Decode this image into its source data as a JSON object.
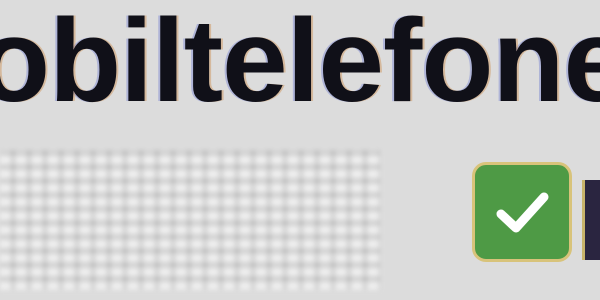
{
  "heading": {
    "text": "obiltelefoner"
  },
  "checkbox": {
    "checked": true,
    "icon": "checkmark-icon",
    "fill_color": "#4e9a45"
  }
}
